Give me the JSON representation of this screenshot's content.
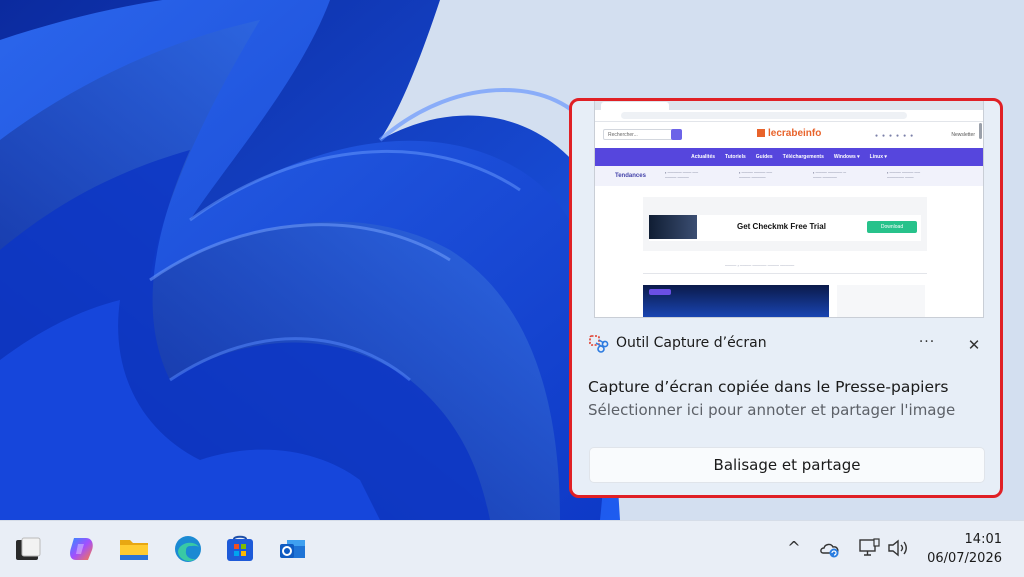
{
  "toast": {
    "app_name": "Outil Capture d’écran",
    "more_label": "···",
    "close_label": "✕",
    "title": "Capture d’écran copiée dans le Presse-papiers",
    "body": "Sélectionner ici pour annoter et partager l'image",
    "action_label": "Balisage et partage",
    "border_color": "#e02025",
    "preview": {
      "search_placeholder": "Rechercher...",
      "site_name": "lecrabeinfo",
      "newsletter": "Newsletter",
      "nav_items": [
        "Actualités",
        "Tutoriels",
        "Guides",
        "Téléchargements",
        "Windows ▾",
        "Linux ▾"
      ],
      "trend_label": "Tendances",
      "ad_text": "Get Checkmk Free Trial",
      "ad_button": "Download"
    }
  },
  "taskbar": {
    "apps": [
      "start-icon",
      "copilot-icon",
      "file-explorer-icon",
      "edge-icon",
      "microsoft-store-icon",
      "outlook-icon"
    ],
    "tray_chevron": "^",
    "time": "14:01",
    "date": "06/07/2026"
  }
}
